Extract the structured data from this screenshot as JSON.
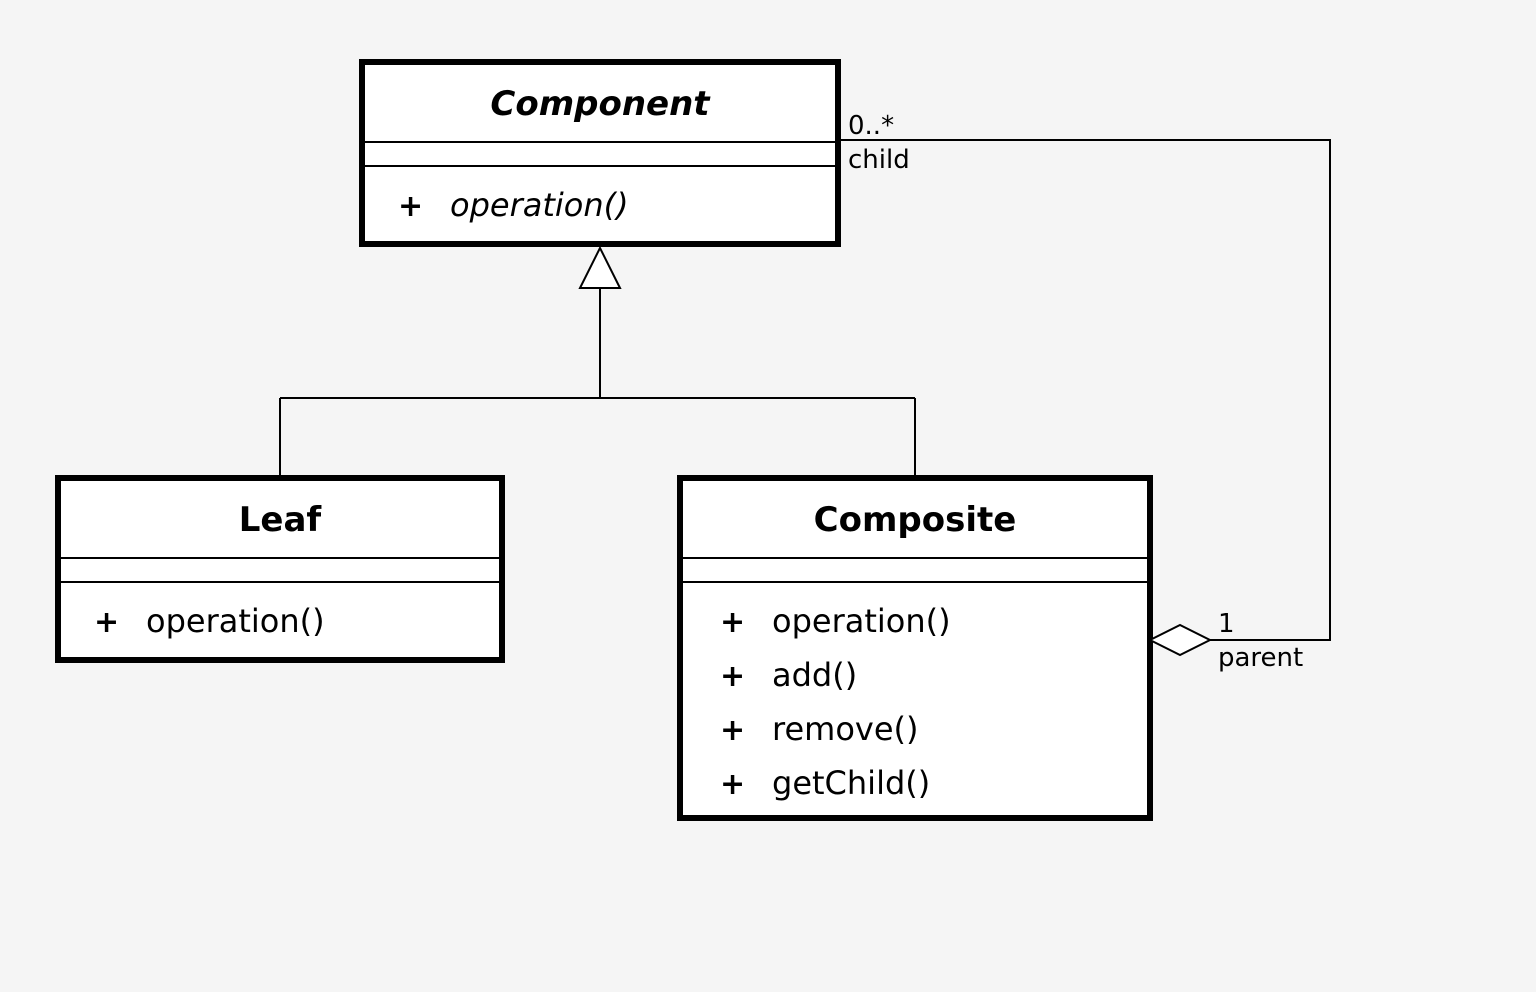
{
  "diagram": {
    "component": {
      "title": "Component",
      "ops": [
        "operation()"
      ]
    },
    "leaf": {
      "title": "Leaf",
      "ops": [
        "operation()"
      ]
    },
    "composite": {
      "title": "Composite",
      "ops": [
        "operation()",
        "add()",
        "remove()",
        "getChild()"
      ]
    },
    "assoc": {
      "child_mult": "0..*",
      "child_role": "child",
      "parent_mult": "1",
      "parent_role": "parent"
    }
  }
}
